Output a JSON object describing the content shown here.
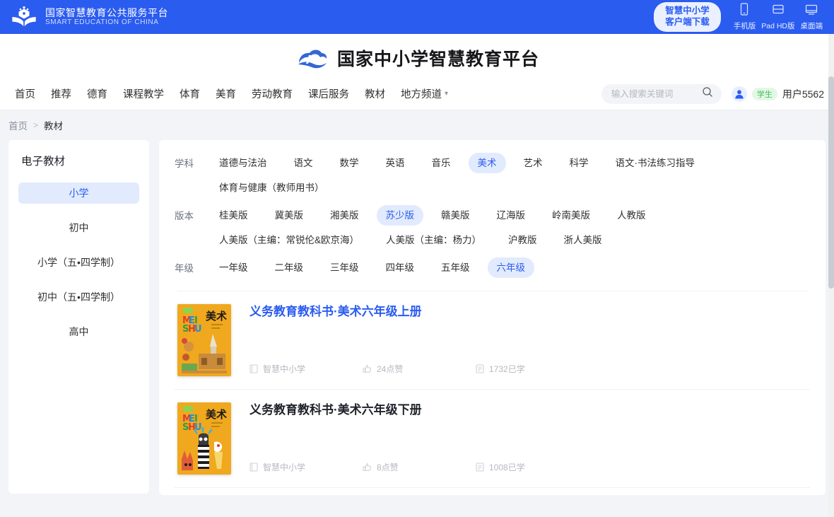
{
  "topbar": {
    "brand_cn": "国家智慧教育公共服务平台",
    "brand_en": "SMART EDUCATION OF CHINA",
    "download_line1": "智慧中小学",
    "download_line2": "客户端下载",
    "devices": [
      {
        "icon": "phone-icon",
        "label": "手机版"
      },
      {
        "icon": "tablet-icon",
        "label": "Pad HD版"
      },
      {
        "icon": "desktop-icon",
        "label": "桌面端"
      }
    ]
  },
  "header": {
    "logo_title": "国家中小学智慧教育平台",
    "nav": [
      {
        "label": "首页",
        "caret": false
      },
      {
        "label": "推荐",
        "caret": false
      },
      {
        "label": "德育",
        "caret": false
      },
      {
        "label": "课程教学",
        "caret": false
      },
      {
        "label": "体育",
        "caret": false
      },
      {
        "label": "美育",
        "caret": false
      },
      {
        "label": "劳动教育",
        "caret": false
      },
      {
        "label": "课后服务",
        "caret": false
      },
      {
        "label": "教材",
        "caret": false
      },
      {
        "label": "地方频道",
        "caret": true
      }
    ],
    "search": {
      "placeholder": "输入搜索关键词",
      "value": ""
    },
    "user": {
      "role_badge": "学生",
      "name": "用户5562"
    }
  },
  "breadcrumb": {
    "home": "首页",
    "separator": ">",
    "current": "教材"
  },
  "sidebar": {
    "title": "电子教材",
    "items": [
      {
        "label": "小学",
        "active": true
      },
      {
        "label": "初中",
        "active": false
      },
      {
        "label": "小学（五•四学制）",
        "active": false
      },
      {
        "label": "初中（五•四学制）",
        "active": false
      },
      {
        "label": "高中",
        "active": false
      }
    ]
  },
  "filters": [
    {
      "label": "学科",
      "options": [
        {
          "label": "道德与法治",
          "active": false
        },
        {
          "label": "语文",
          "active": false
        },
        {
          "label": "数学",
          "active": false
        },
        {
          "label": "英语",
          "active": false
        },
        {
          "label": "音乐",
          "active": false
        },
        {
          "label": "美术",
          "active": true
        },
        {
          "label": "艺术",
          "active": false
        },
        {
          "label": "科学",
          "active": false
        },
        {
          "label": "语文·书法练习指导",
          "active": false
        },
        {
          "label": "体育与健康（教师用书）",
          "active": false
        }
      ]
    },
    {
      "label": "版本",
      "options": [
        {
          "label": "桂美版",
          "active": false
        },
        {
          "label": "冀美版",
          "active": false
        },
        {
          "label": "湘美版",
          "active": false
        },
        {
          "label": "苏少版",
          "active": true
        },
        {
          "label": "赣美版",
          "active": false
        },
        {
          "label": "辽海版",
          "active": false
        },
        {
          "label": "岭南美版",
          "active": false
        },
        {
          "label": "人教版",
          "active": false
        },
        {
          "label": "人美版（主编：常锐伦&欧京海）",
          "active": false
        },
        {
          "label": "人美版（主编：杨力）",
          "active": false
        },
        {
          "label": "沪教版",
          "active": false
        },
        {
          "label": "浙人美版",
          "active": false
        }
      ]
    },
    {
      "label": "年级",
      "options": [
        {
          "label": "一年级",
          "active": false
        },
        {
          "label": "二年级",
          "active": false
        },
        {
          "label": "三年级",
          "active": false
        },
        {
          "label": "四年级",
          "active": false
        },
        {
          "label": "五年级",
          "active": false
        },
        {
          "label": "六年级",
          "active": true
        }
      ]
    }
  ],
  "books": [
    {
      "title": "义务教育教科书·美术六年级上册",
      "title_style": "link",
      "cover_alt": "美术 MEI SHU 教材封面",
      "source_icon": "book-icon",
      "source": "智慧中小学",
      "likes_icon": "thumbs-up-icon",
      "likes": "24点赞",
      "learners_icon": "study-icon",
      "learners": "1732已学"
    },
    {
      "title": "义务教育教科书·美术六年级下册",
      "title_style": "plain",
      "cover_alt": "美术 MEI SHU 教材封面",
      "source_icon": "book-icon",
      "source": "智慧中小学",
      "likes_icon": "thumbs-up-icon",
      "likes": "8点赞",
      "learners_icon": "study-icon",
      "learners": "1008已学"
    }
  ],
  "colors": {
    "brand_blue": "#2b5cf0",
    "chip_active_bg": "#e2ebfd",
    "badge_green": "#3fbe56"
  }
}
